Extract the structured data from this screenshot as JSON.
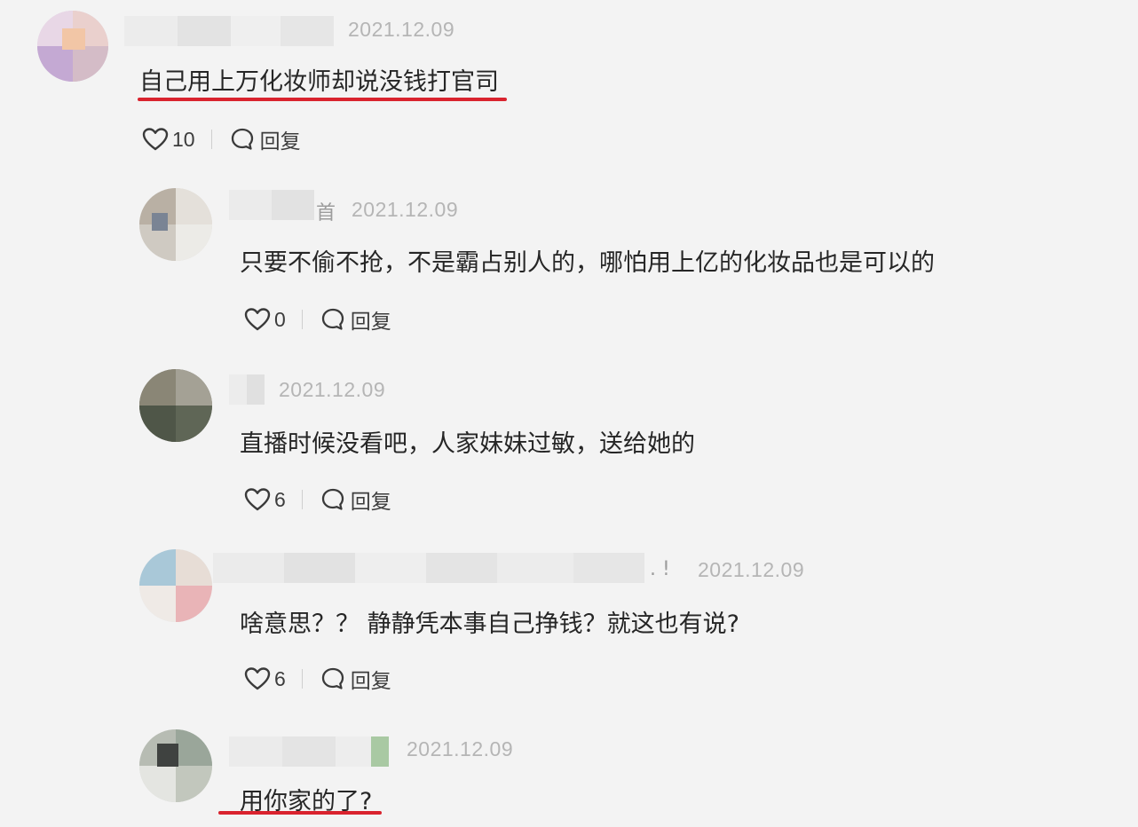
{
  "comments": [
    {
      "date": "2021.12.09",
      "text": "自己用上万化妆师却说没钱打官司",
      "likes": "10",
      "reply_label": "回复",
      "underlined": true
    },
    {
      "date": "2021.12.09",
      "name_suffix": "首",
      "text": "只要不偷不抢，不是霸占别人的，哪怕用上亿的化妆品也是可以的",
      "likes": "0",
      "reply_label": "回复",
      "underlined": false
    },
    {
      "date": "2021.12.09",
      "text": "直播时候没看吧，人家妹妹过敏，送给她的",
      "likes": "6",
      "reply_label": "回复",
      "underlined": false
    },
    {
      "date": "2021.12.09",
      "name_suffix": ". !",
      "text": "啥意思？？ 静静凭本事自己挣钱？就这也有说?",
      "likes": "6",
      "reply_label": "回复",
      "underlined": false
    },
    {
      "date": "2021.12.09",
      "text": "用你家的了?",
      "underlined": true
    }
  ],
  "colors": {
    "underline": "#d9232e",
    "date": "#b5b5b5",
    "background": "#f3f3f3"
  },
  "icons": {
    "like": "heart-outline-icon",
    "reply": "speech-bubble-icon"
  }
}
